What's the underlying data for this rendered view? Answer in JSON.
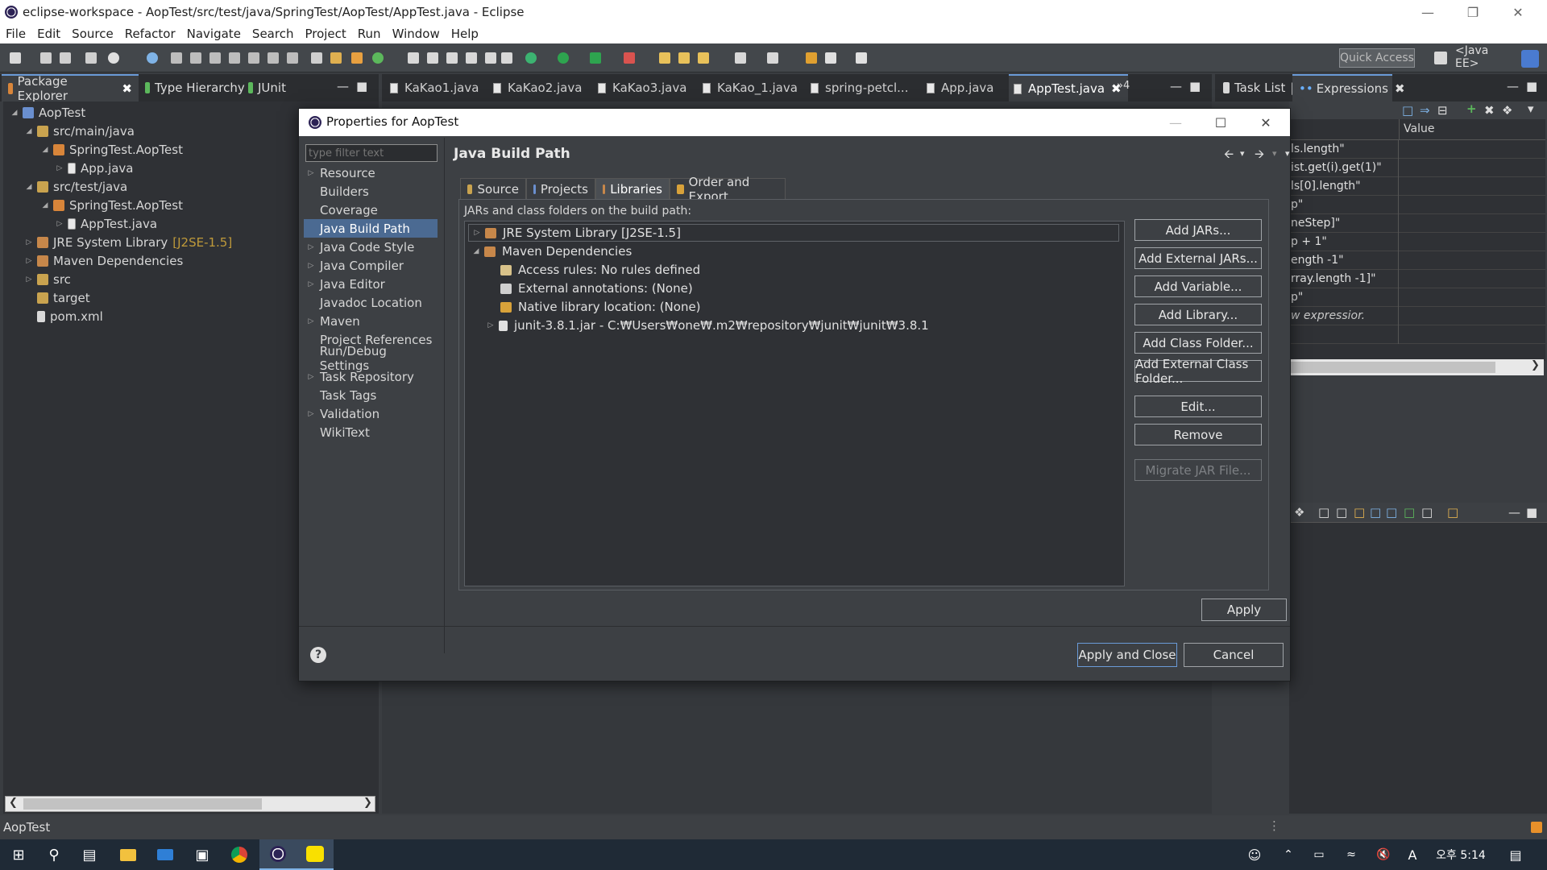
{
  "window": {
    "title": "eclipse-workspace - AopTest/src/test/java/SpringTest/AopTest/AppTest.java - Eclipse"
  },
  "menu": [
    "File",
    "Edit",
    "Source",
    "Refactor",
    "Navigate",
    "Search",
    "Project",
    "Run",
    "Window",
    "Help"
  ],
  "toolbar": {
    "quick_access": "Quick Access",
    "perspective": "<Java EE>"
  },
  "left_panel": {
    "tabs": [
      "Package Explorer",
      "Type Hierarchy",
      "JUnit"
    ],
    "tree": [
      {
        "label": "AopTest",
        "decoration": ""
      },
      {
        "label": "src/main/java",
        "decoration": ""
      },
      {
        "label": "SpringTest.AopTest",
        "decoration": ""
      },
      {
        "label": "App.java",
        "decoration": ""
      },
      {
        "label": "src/test/java",
        "decoration": ""
      },
      {
        "label": "SpringTest.AopTest",
        "decoration": ""
      },
      {
        "label": "AppTest.java",
        "decoration": ""
      },
      {
        "label": "JRE System Library",
        "decoration": "[J2SE-1.5]"
      },
      {
        "label": "Maven Dependencies",
        "decoration": ""
      },
      {
        "label": "src",
        "decoration": ""
      },
      {
        "label": "target",
        "decoration": ""
      },
      {
        "label": "pom.xml",
        "decoration": ""
      }
    ]
  },
  "editor": {
    "tabs": [
      "KaKao1.java",
      "KaKao2.java",
      "KaKao3.java",
      "KaKao_1.java",
      "spring-petcl...",
      "App.java",
      "AppTest.java"
    ],
    "overflow": "»4"
  },
  "right_panel": {
    "tabs": [
      "Task List",
      "Expressions"
    ],
    "value_header": "Value",
    "expressions": [
      "ls.length\"",
      "ist.get(i).get(1)\"",
      "ls[0].length\"",
      "p\"",
      "neStep]\"",
      "p + 1\"",
      "ength -1\"",
      "rray.length -1]\"",
      "p\"",
      "w expressior."
    ]
  },
  "status": {
    "text": "AopTest"
  },
  "taskbar": {
    "time": "오후 5:14"
  },
  "dialog": {
    "title": "Properties for AopTest",
    "filter_placeholder": "type filter text",
    "nav": [
      {
        "label": "Resource",
        "expandable": true
      },
      {
        "label": "Builders",
        "expandable": false
      },
      {
        "label": "Coverage",
        "expandable": false
      },
      {
        "label": "Java Build Path",
        "expandable": false,
        "selected": true
      },
      {
        "label": "Java Code Style",
        "expandable": true
      },
      {
        "label": "Java Compiler",
        "expandable": true
      },
      {
        "label": "Java Editor",
        "expandable": true
      },
      {
        "label": "Javadoc Location",
        "expandable": false
      },
      {
        "label": "Maven",
        "expandable": true
      },
      {
        "label": "Project References",
        "expandable": false
      },
      {
        "label": "Run/Debug Settings",
        "expandable": false
      },
      {
        "label": "Task Repository",
        "expandable": true
      },
      {
        "label": "Task Tags",
        "expandable": false
      },
      {
        "label": "Validation",
        "expandable": true
      },
      {
        "label": "WikiText",
        "expandable": false
      }
    ],
    "page_title": "Java Build Path",
    "tabs": [
      "Source",
      "Projects",
      "Libraries",
      "Order and Export"
    ],
    "active_tab": "Libraries",
    "caption": "JARs and class folders on the build path:",
    "libraries": [
      {
        "label": "JRE System Library [J2SE-1.5]",
        "twisty": "▷"
      },
      {
        "label": "Maven Dependencies",
        "twisty": "◢"
      },
      {
        "label": "Access rules: No rules defined",
        "twisty": ""
      },
      {
        "label": "External annotations: (None)",
        "twisty": ""
      },
      {
        "label": "Native library location: (None)",
        "twisty": ""
      },
      {
        "label": "junit-3.8.1.jar - C:₩Users₩one₩.m2₩repository₩junit₩junit₩3.8.1",
        "twisty": "▷"
      }
    ],
    "buttons": {
      "add_jars": "Add JARs...",
      "add_external_jars": "Add External JARs...",
      "add_variable": "Add Variable...",
      "add_library": "Add Library...",
      "add_class_folder": "Add Class Folder...",
      "add_external_class_folder": "Add External Class Folder...",
      "edit": "Edit...",
      "remove": "Remove",
      "migrate_jar": "Migrate JAR File...",
      "apply": "Apply",
      "apply_and_close": "Apply and Close",
      "cancel": "Cancel"
    },
    "help": "?"
  }
}
